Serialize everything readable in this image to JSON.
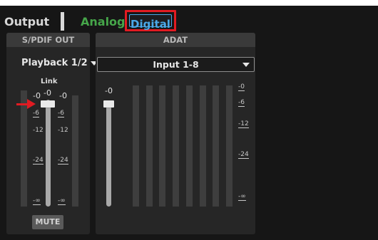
{
  "tabs": {
    "output": "Output",
    "analog": "Analog",
    "digital": "Digital"
  },
  "spdif": {
    "header": "S/PDIF OUT",
    "playback_label": "Playback 1/2",
    "link_label": "Link",
    "mute_label": "MUTE",
    "top_values": {
      "left": "-0",
      "fader": "-0",
      "right": "-0"
    },
    "scale_left": [
      "-6",
      "-12",
      "-24",
      "-∞"
    ],
    "scale_right": [
      "-6",
      "-12",
      "-24",
      "-∞"
    ],
    "fader_level": 0.93
  },
  "adat": {
    "header": "ADAT",
    "input_select": "Input 1-8",
    "fader_value": "-0",
    "scale": [
      "-0",
      "-6",
      "-12",
      "-24",
      "-∞"
    ],
    "fader_level": 0.93,
    "channel_count": 8
  },
  "colors": {
    "accent_blue": "#4aa8e8",
    "analog_green": "#46a64a",
    "highlight_red": "#e11b22",
    "background": "#161616",
    "panel": "#262626"
  },
  "icons": {
    "playback_caret": "chevron-down-icon",
    "select_caret": "chevron-down-icon",
    "annotation": "arrow-right-icon"
  }
}
